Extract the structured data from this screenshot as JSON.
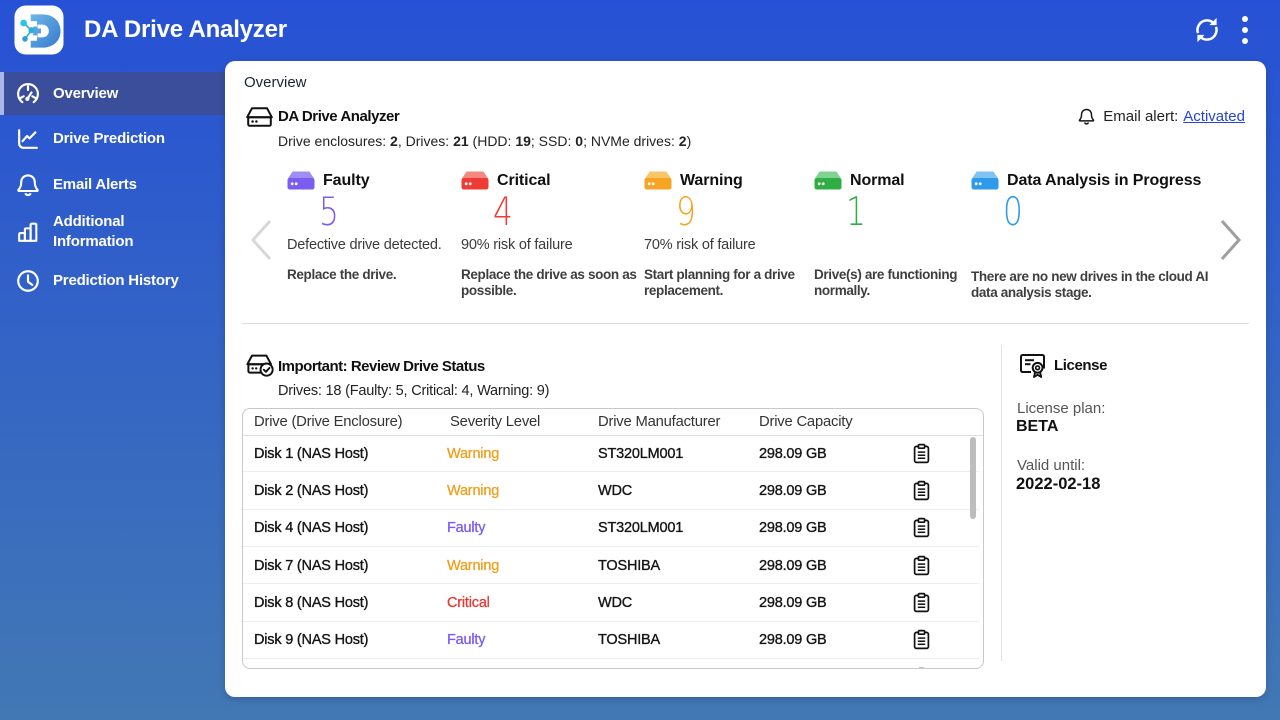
{
  "app": {
    "title": "DA Drive Analyzer"
  },
  "page": {
    "title": "Overview"
  },
  "sidebar": {
    "items": [
      {
        "label": "Overview",
        "active": true
      },
      {
        "label": "Drive Prediction",
        "active": false
      },
      {
        "label": "Email Alerts",
        "active": false
      },
      {
        "label": "Additional Information",
        "active": false
      },
      {
        "label": "Prediction History",
        "active": false
      }
    ]
  },
  "summary": {
    "title": "DA Drive Analyzer",
    "subtitle_segments": [
      {
        "t": "Drive enclosures: "
      },
      {
        "t": "2",
        "b": 1
      },
      {
        "t": ", Drives: "
      },
      {
        "t": "21",
        "b": 1
      },
      {
        "t": " (HDD: "
      },
      {
        "t": "19",
        "b": 1
      },
      {
        "t": "; SSD: "
      },
      {
        "t": "0",
        "b": 1
      },
      {
        "t": "; NVMe drives: "
      },
      {
        "t": "2",
        "b": 1
      },
      {
        "t": ")"
      }
    ],
    "email_alert": {
      "label": "Email alert:",
      "status": "Activated",
      "link_color": "#2543d9"
    }
  },
  "status_cards": [
    {
      "title": "Faulty",
      "count": "5",
      "color": "#7a5cf0",
      "icon_top": "#a18ef5",
      "desc": "Defective drive detected.",
      "action": "Replace the drive."
    },
    {
      "title": "Critical",
      "count": "4",
      "color": "#ee3b35",
      "icon_top": "#f48981",
      "desc": "90% risk of failure",
      "action": "Replace the drive as soon as possible."
    },
    {
      "title": "Warning",
      "count": "9",
      "color": "#f5a423",
      "icon_top": "#f8c668",
      "desc": "70% risk of failure",
      "action": "Start planning for a drive replacement."
    },
    {
      "title": "Normal",
      "count": "1",
      "color": "#2fae43",
      "icon_top": "#7fd492",
      "desc": "",
      "action": "Drive(s) are functioning normally."
    },
    {
      "title": "Data Analysis in Progress",
      "count": "0",
      "color": "#2e9ae9",
      "icon_top": "#7fc4f2",
      "desc": "",
      "action": "There are no new drives in the cloud AI data analysis stage."
    }
  ],
  "drive_status": {
    "title": "Important: Review Drive Status",
    "subtitle": "Drives: 18 (Faulty: 5, Critical: 4, Warning: 9)",
    "table": {
      "headers": [
        "Drive (Drive Enclosure)",
        "Severity Level",
        "Drive Manufacturer",
        "Drive Capacity"
      ],
      "rows": [
        {
          "drive": "Disk 1 (NAS Host)",
          "severity": "Warning",
          "severity_color": "#f0a01e",
          "manufacturer": "ST320LM001",
          "capacity": "298.09 GB"
        },
        {
          "drive": "Disk 2 (NAS Host)",
          "severity": "Warning",
          "severity_color": "#f0a01e",
          "manufacturer": "WDC",
          "capacity": "298.09 GB"
        },
        {
          "drive": "Disk 4 (NAS Host)",
          "severity": "Faulty",
          "severity_color": "#7a5cf5",
          "manufacturer": "ST320LM001",
          "capacity": "298.09 GB"
        },
        {
          "drive": "Disk 7 (NAS Host)",
          "severity": "Warning",
          "severity_color": "#f0a01e",
          "manufacturer": "TOSHIBA",
          "capacity": "298.09 GB"
        },
        {
          "drive": "Disk 8 (NAS Host)",
          "severity": "Critical",
          "severity_color": "#e53935",
          "manufacturer": "WDC",
          "capacity": "298.09 GB"
        },
        {
          "drive": "Disk 9 (NAS Host)",
          "severity": "Faulty",
          "severity_color": "#7a5cf5",
          "manufacturer": "TOSHIBA",
          "capacity": "298.09 GB"
        },
        {
          "drive": "",
          "severity": "",
          "severity_color": "",
          "manufacturer": "",
          "capacity": ""
        }
      ]
    }
  },
  "license": {
    "title": "License",
    "plan_label": "License plan:",
    "plan": "BETA",
    "valid_label": "Valid until:",
    "valid": "2022-02-18"
  }
}
